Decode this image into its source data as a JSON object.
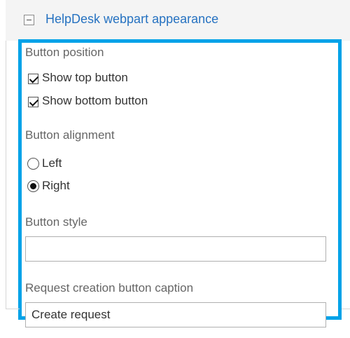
{
  "section": {
    "title": "HelpDesk webpart appearance",
    "toggle_icon": "collapse-minus-icon"
  },
  "button_position": {
    "label": "Button position",
    "options": [
      {
        "label": "Show top button",
        "checked": true
      },
      {
        "label": "Show bottom button",
        "checked": true
      }
    ]
  },
  "button_alignment": {
    "label": "Button alignment",
    "options": [
      {
        "label": "Left",
        "selected": false
      },
      {
        "label": "Right",
        "selected": true
      }
    ]
  },
  "button_style": {
    "label": "Button style",
    "value": ""
  },
  "caption": {
    "label": "Request creation button caption",
    "value": "Create request"
  },
  "colors": {
    "highlight_border": "#00a2e8",
    "title": "#2672c1",
    "header_bg": "#f4f4f4"
  }
}
